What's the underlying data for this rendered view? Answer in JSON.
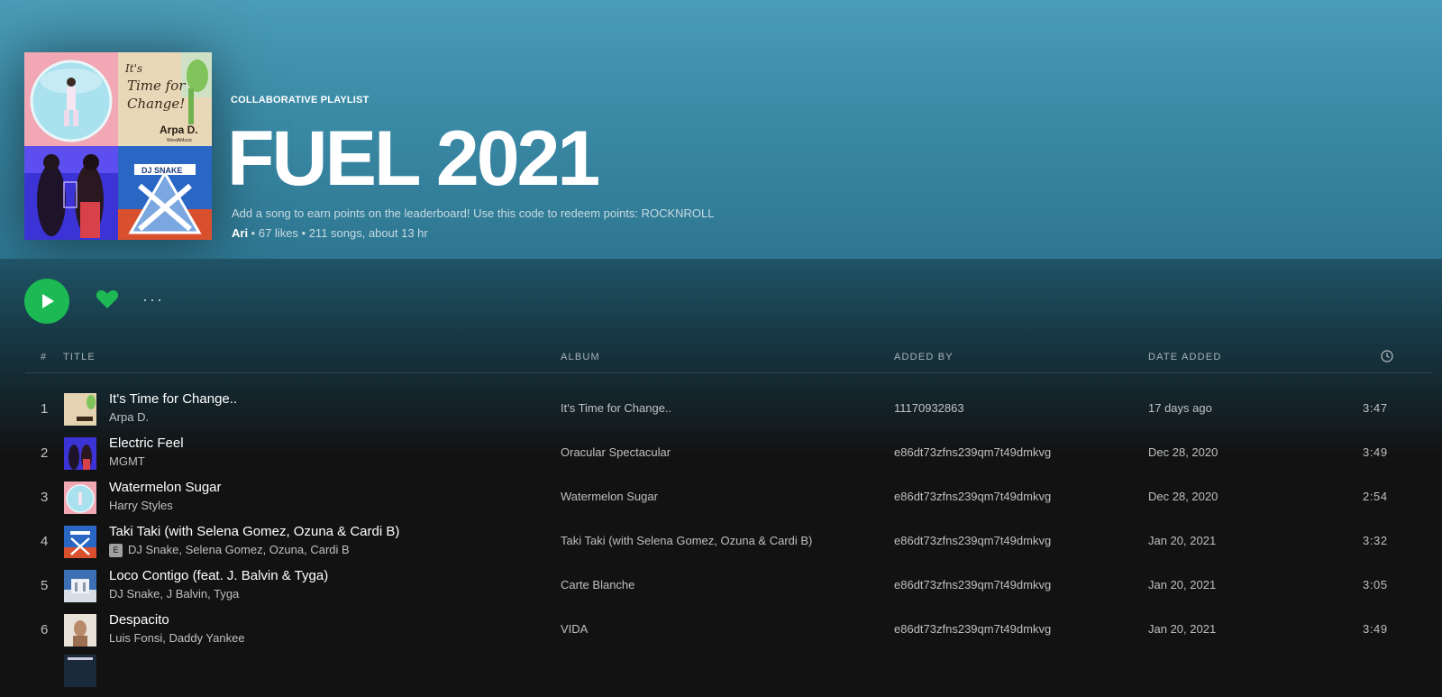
{
  "playlist": {
    "type_label": "COLLABORATIVE PLAYLIST",
    "title": "FUEL 2021",
    "description": "Add a song to earn points on the leaderboard! Use this code to redeem points: ROCKNROLL",
    "owner": "Ari",
    "likes": "67 likes",
    "stats": "211 songs, about 13 hr",
    "separator": " • "
  },
  "cover_text": {
    "tile2_title_1": "It's",
    "tile2_title_2": "Time for",
    "tile2_title_3": "Change!",
    "tile2_artist": "Arpa D.",
    "tile2_label": "WordAMusic",
    "tile4_artist": "DJ SNAKE"
  },
  "controls": {
    "play_icon": "play-icon",
    "heart_icon": "heart-icon",
    "more_icon": "more-icon",
    "more_label": "···",
    "accent": "#1db954"
  },
  "table": {
    "headers": {
      "index": "#",
      "title": "TITLE",
      "album": "ALBUM",
      "added_by": "ADDED BY",
      "date_added": "DATE ADDED",
      "duration_icon": "clock-icon"
    },
    "rows": [
      {
        "index": "1",
        "title": "It's Time for Change..",
        "artist": "Arpa D.",
        "explicit": false,
        "album": "It's Time for Change..",
        "added_by": "11170932863",
        "date_added": "17 days ago",
        "duration": "3:47"
      },
      {
        "index": "2",
        "title": "Electric Feel",
        "artist": "MGMT",
        "explicit": false,
        "album": "Oracular Spectacular",
        "added_by": "e86dt73zfns239qm7t49dmkvg",
        "date_added": "Dec 28, 2020",
        "duration": "3:49"
      },
      {
        "index": "3",
        "title": "Watermelon Sugar",
        "artist": "Harry Styles",
        "explicit": false,
        "album": "Watermelon Sugar",
        "added_by": "e86dt73zfns239qm7t49dmkvg",
        "date_added": "Dec 28, 2020",
        "duration": "2:54"
      },
      {
        "index": "4",
        "title": "Taki Taki (with Selena Gomez, Ozuna & Cardi B)",
        "artist": "DJ Snake, Selena Gomez, Ozuna, Cardi B",
        "explicit": true,
        "explicit_label": "E",
        "album": "Taki Taki (with Selena Gomez, Ozuna & Cardi B)",
        "added_by": "e86dt73zfns239qm7t49dmkvg",
        "date_added": "Jan 20, 2021",
        "duration": "3:32"
      },
      {
        "index": "5",
        "title": "Loco Contigo (feat. J. Balvin & Tyga)",
        "artist": "DJ Snake, J Balvin, Tyga",
        "explicit": false,
        "album": "Carte Blanche",
        "added_by": "e86dt73zfns239qm7t49dmkvg",
        "date_added": "Jan 20, 2021",
        "duration": "3:05"
      },
      {
        "index": "6",
        "title": "Despacito",
        "artist": "Luis Fonsi, Daddy Yankee",
        "explicit": false,
        "album": "VIDA",
        "added_by": "e86dt73zfns239qm7t49dmkvg",
        "date_added": "Jan 20, 2021",
        "duration": "3:49"
      }
    ]
  }
}
